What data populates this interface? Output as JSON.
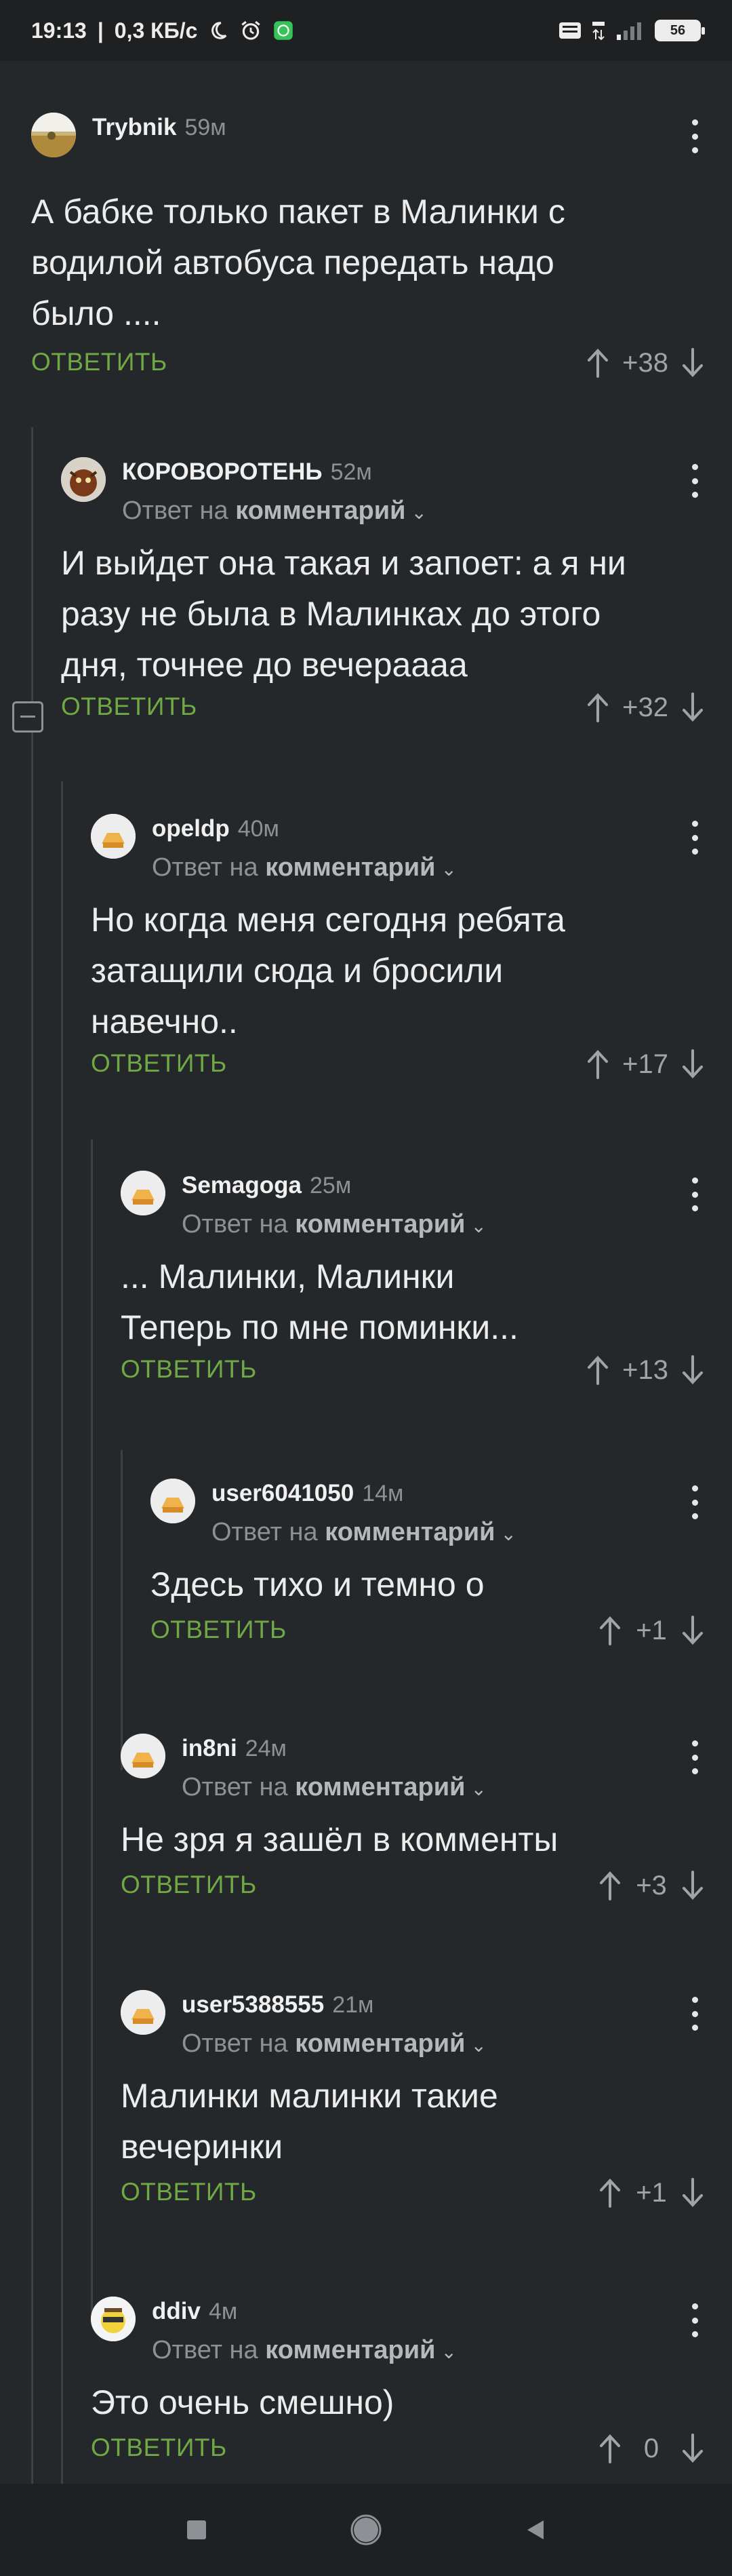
{
  "status_bar": {
    "time": "19:13",
    "network_speed": "0,3 КБ/с",
    "battery": "56",
    "icons": [
      "moon-icon",
      "alarm-icon",
      "whatsapp-icon",
      "volte-icon",
      "4g-icon",
      "signal-icon",
      "battery-icon"
    ]
  },
  "colors": {
    "background": "#25282a",
    "reply": "#6fa845",
    "muted": "#8d9195",
    "thread_line": "#3d4144"
  },
  "labels": {
    "reply": "ОТВЕТИТЬ",
    "reply_to_prefix": "Ответ на",
    "reply_to_link": "комментарий"
  },
  "comments": [
    {
      "author": "Trybnik",
      "time": "59м",
      "text": "А бабке только пакет в Малинки с\nводилой автобуса передать надо\nбыло ....",
      "score": "+38",
      "is_reply": false
    },
    {
      "author": "КОРОВОРОТЕНЬ",
      "time": "52м",
      "text": "И выйдет она такая и запоет: а я ни\nразу не была в Малинках до этого\nдня, точнее до вечераааа",
      "score": "+32",
      "is_reply": true
    },
    {
      "author": "opeldp",
      "time": "40м",
      "text": "Но когда меня сегодня ребята\nзатащили сюда и бросили\nнавечно..",
      "score": "+17",
      "is_reply": true
    },
    {
      "author": "Semagoga",
      "time": "25м",
      "text": "... Малинки, Малинки\nТеперь по мне поминки...",
      "score": "+13",
      "is_reply": true
    },
    {
      "author": "user6041050",
      "time": "14м",
      "text": "Здесь тихо и темно о",
      "score": "+1",
      "is_reply": true
    },
    {
      "author": "in8ni",
      "time": "24м",
      "text": "Не зря я зашёл в комменты",
      "score": "+3",
      "is_reply": true
    },
    {
      "author": "user5388555",
      "time": "21м",
      "text": "Малинки малинки такие\nвечеринки",
      "score": "+1",
      "is_reply": true
    },
    {
      "author": "ddiv",
      "time": "4м",
      "text": "Это очень смешно)",
      "score": "0",
      "is_reply": true
    }
  ],
  "nav": [
    "recents-button",
    "home-button",
    "back-button"
  ]
}
